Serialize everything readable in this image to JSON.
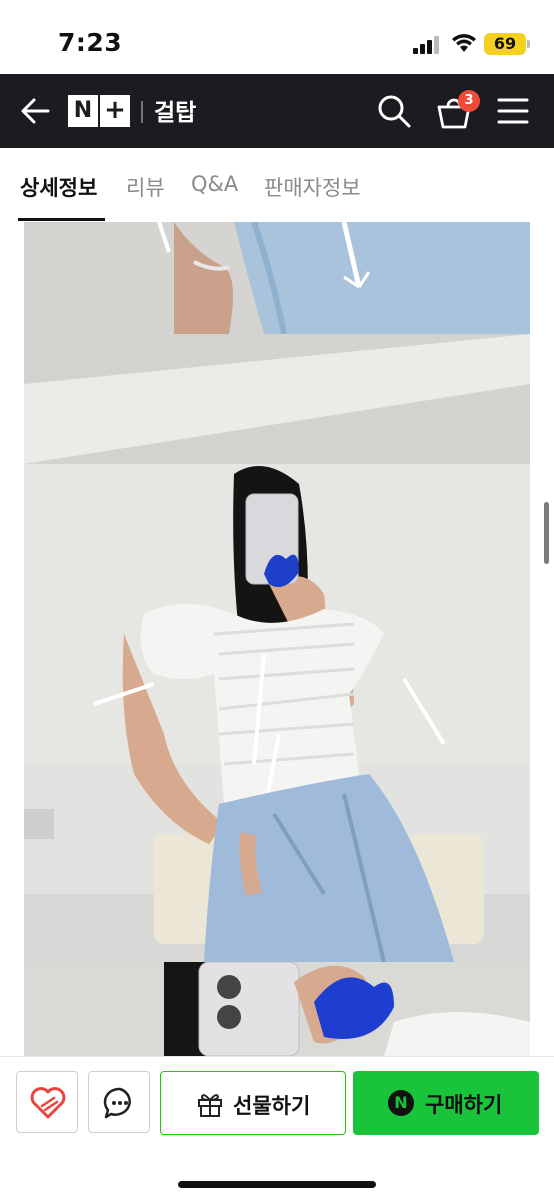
{
  "status_bar": {
    "time": "7:23",
    "battery": "69"
  },
  "header": {
    "logo_n": "N",
    "logo_plus": "+",
    "brand": "걸탑",
    "cart_count": "3"
  },
  "tabs": [
    {
      "label": "상세정보",
      "active": true
    },
    {
      "label": "리뷰",
      "active": false
    },
    {
      "label": "Q&A",
      "active": false
    },
    {
      "label": "판매자정보",
      "active": false
    }
  ],
  "bottom_bar": {
    "gift_label": "선물하기",
    "buy_icon": "N",
    "buy_label": "구매하기"
  },
  "colors": {
    "header_bg": "#1a1c1f",
    "buy_green": "#19c33a",
    "badge_red": "#f04a3a",
    "wish_red": "#e8453c"
  },
  "icons": [
    "back-arrow-icon",
    "search-icon",
    "cart-icon",
    "menu-icon",
    "heart-share-icon",
    "chat-icon",
    "gift-icon"
  ]
}
